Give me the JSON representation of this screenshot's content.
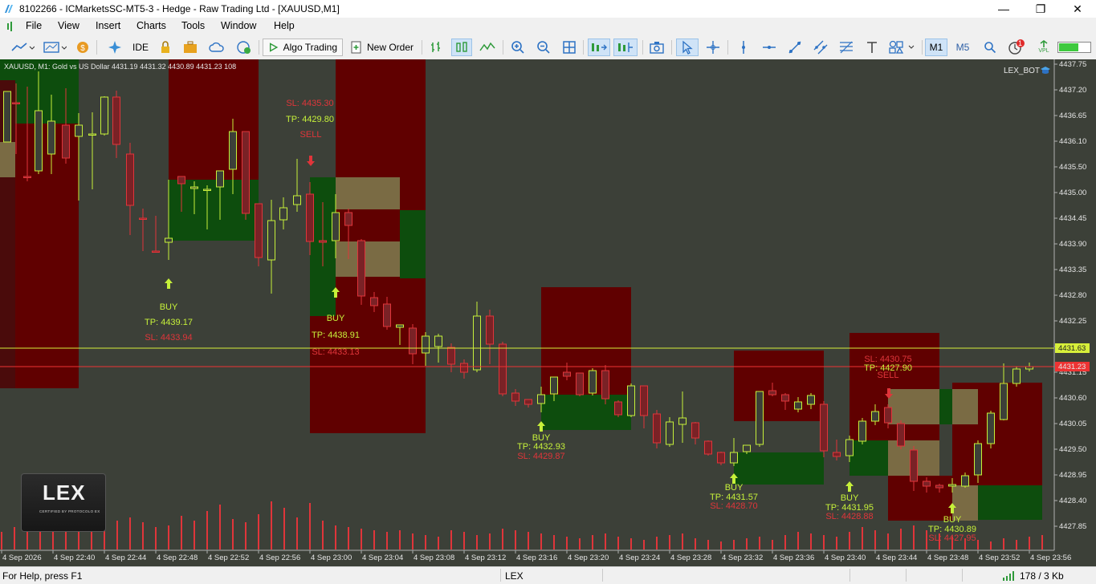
{
  "window": {
    "title": "8102266 - ICMarketsSC-MT5-3 - Hedge - Raw Trading Ltd - [XAUUSD,M1]",
    "minimize": "—",
    "maximize": "❐",
    "close": "✕"
  },
  "menu": {
    "items": [
      "File",
      "View",
      "Insert",
      "Charts",
      "Tools",
      "Window",
      "Help"
    ]
  },
  "toolbar": {
    "ide_label": "IDE",
    "algo_trading_label": "Algo Trading",
    "new_order_label": "New Order",
    "timeframe_m1": "M1",
    "timeframe_m5": "M5",
    "notification_count": "1",
    "vpl_label": "VPL"
  },
  "chart": {
    "symbol_info": "XAUUSD, M1:  Gold vs US Dollar  4431.19 4431.32 4430.89 4431.23  108",
    "ea_name": "LEX_BOT",
    "logo_big": "LEX",
    "logo_small": "CERTIFIED BY PROTOCOLO EX",
    "price_ticks": [
      "4437.75",
      "4437.20",
      "4436.65",
      "4436.10",
      "4435.50",
      "4435.00",
      "4434.45",
      "4433.90",
      "4433.35",
      "4432.80",
      "4432.25",
      "4431.70",
      "4431.15",
      "4430.60",
      "4430.05",
      "4429.50",
      "4428.95",
      "4428.40",
      "4427.85"
    ],
    "time_ticks": [
      "4 Sep 2026",
      "4 Sep 22:40",
      "4 Sep 22:44",
      "4 Sep 22:48",
      "4 Sep 22:52",
      "4 Sep 22:56",
      "4 Sep 23:00",
      "4 Sep 23:04",
      "4 Sep 23:08",
      "4 Sep 23:12",
      "4 Sep 23:16",
      "4 Sep 23:20",
      "4 Sep 23:24",
      "4 Sep 23:28",
      "4 Sep 23:32",
      "4 Sep 23:36",
      "4 Sep 23:40",
      "4 Sep 23:44",
      "4 Sep 23:48",
      "4 Sep 23:52",
      "4 Sep 23:56"
    ],
    "ask_price_label": "4431.63",
    "bid_price_label": "4431.23",
    "signals": [
      {
        "type": "BUY",
        "label": "BUY",
        "tp": "TP: 4439.17",
        "sl": "SL: 4433.94"
      },
      {
        "type": "SELL",
        "label": "SELL",
        "tp": "TP: 4429.80",
        "sl": "SL: 4435.30"
      },
      {
        "type": "BUY",
        "label": "BUY",
        "tp": "TP: 4438.91",
        "sl": "SL: 4433.13"
      },
      {
        "type": "BUY",
        "label": "BUY",
        "tp": "TP: 4432.93",
        "sl": "SL: 4429.87"
      },
      {
        "type": "BUY",
        "label": "BUY",
        "tp": "TP: 4431.57",
        "sl": "SL: 4428.70"
      },
      {
        "type": "BUY",
        "label": "BUY",
        "tp": "TP: 4431.95",
        "sl": "SL: 4428.88"
      },
      {
        "type": "SELL",
        "label": "SELL",
        "tp": "TP: 4427.90",
        "sl": "SL: 4430.75"
      },
      {
        "type": "BUY",
        "label": "BUY",
        "tp": "TP: 4430.89",
        "sl": "SL: 4427.95"
      }
    ],
    "colors": {
      "background": "#3c4038",
      "bull": "#c6f03a",
      "bear": "#e0353a",
      "ask_line": "#d7ef3a",
      "bid_line": "#ee3333"
    }
  },
  "status": {
    "help": "For Help, press F1",
    "profile": "LEX",
    "traffic": "178 / 3 Kb"
  }
}
